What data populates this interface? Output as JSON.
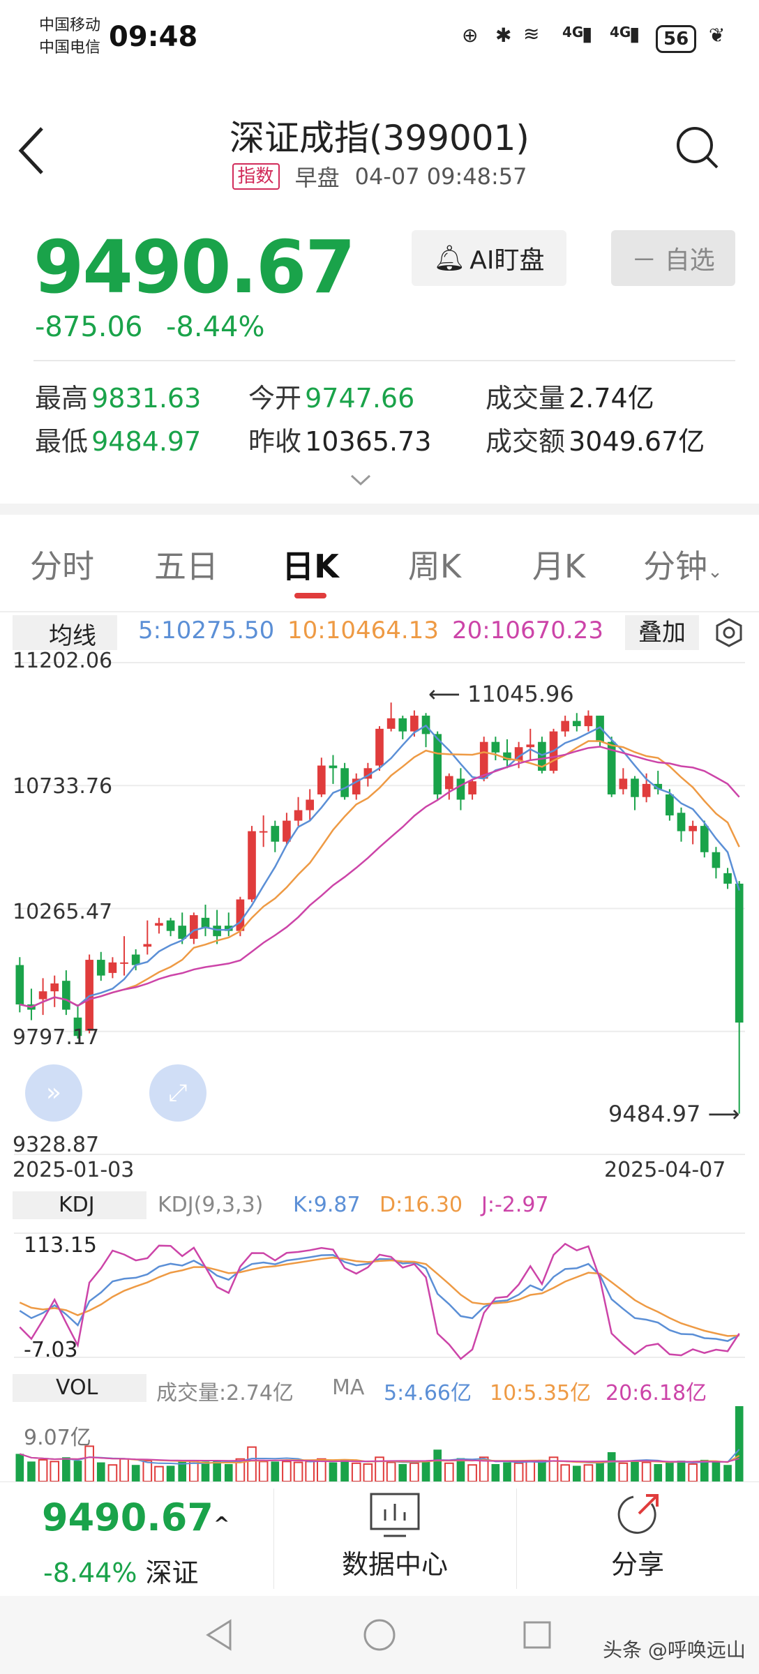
{
  "status_bar": {
    "carrier1": "中国移动",
    "carrier2": "中国电信",
    "time": "09:48",
    "signal1": "4G",
    "signal2": "4G",
    "battery": "56"
  },
  "header": {
    "title": "深证成指(399001)",
    "badge": "指数",
    "session": "早盘",
    "datetime": "04-07 09:48:57"
  },
  "quote": {
    "price": "9490.67",
    "change": "-875.06",
    "change_pct": "-8.44%",
    "ai_button": "AI盯盘",
    "fav_button": "－ 自选"
  },
  "stats": {
    "high_label": "最高",
    "high": "9831.63",
    "low_label": "最低",
    "low": "9484.97",
    "open_label": "今开",
    "open": "9747.66",
    "prev_label": "昨收",
    "prev": "10365.73",
    "vol_label": "成交量",
    "vol": "2.74亿",
    "amt_label": "成交额",
    "amt": "3049.67亿"
  },
  "tabs": [
    "分时",
    "五日",
    "日K",
    "周K",
    "月K",
    "分钟"
  ],
  "ma_bar": {
    "label": "均线",
    "ma5": "5:10275.50",
    "ma10": "10:10464.13",
    "ma20": "20:10670.23",
    "overlay": "叠加"
  },
  "kline": {
    "y_labels": [
      "11202.06",
      "10733.76",
      "10265.47",
      "9797.17",
      "9328.87"
    ],
    "high_mark": "11045.96",
    "low_mark": "9484.97",
    "date_start": "2025-01-03",
    "date_end": "2025-04-07"
  },
  "kdj": {
    "label": "KDJ",
    "params": "KDJ(9,3,3)",
    "k": "K:9.87",
    "d": "D:16.30",
    "j": "J:-2.97",
    "y_top": "113.15",
    "y_bottom": "-7.03"
  },
  "vol": {
    "label": "VOL",
    "amount": "成交量:2.74亿",
    "ma": "MA",
    "ma5": "5:4.66亿",
    "ma10": "10:5.35亿",
    "ma20": "20:6.18亿",
    "y_top": "9.07亿"
  },
  "bottom": {
    "price": "9490.67",
    "pct": "-8.44%",
    "market": "深证",
    "data_center": "数据中心",
    "share": "分享"
  },
  "watermark": "头条 @呼唤远山",
  "colors": {
    "up": "#e03c3c",
    "down": "#1aa34a",
    "ma5": "#5b8fd6",
    "ma10": "#ee9a44",
    "ma20": "#cc44a8"
  },
  "chart_data": {
    "type": "candlestick",
    "x_start": "2025-01-03",
    "x_end": "2025-04-07",
    "ylim": [
      9328.87,
      11202.06
    ],
    "candles": [
      [
        10050,
        10080,
        9900,
        9870
      ],
      [
        9900,
        9960,
        9880,
        9840
      ],
      [
        9920,
        10000,
        9950,
        9860
      ],
      [
        9950,
        10010,
        9980,
        9890
      ],
      [
        9990,
        10030,
        9880,
        9860
      ],
      [
        9850,
        9900,
        9780,
        9770
      ],
      [
        9800,
        10090,
        10070,
        9790
      ],
      [
        10070,
        10100,
        10010,
        9990
      ],
      [
        10020,
        10080,
        10060,
        10000
      ],
      [
        10060,
        10160,
        10060,
        10010
      ],
      [
        10090,
        10110,
        10050,
        10030
      ],
      [
        10120,
        10220,
        10130,
        10090
      ],
      [
        10200,
        10230,
        10210,
        10170
      ],
      [
        10220,
        10230,
        10180,
        10160
      ],
      [
        10200,
        10250,
        10150,
        10130
      ],
      [
        10150,
        10250,
        10240,
        10130
      ],
      [
        10230,
        10280,
        10190,
        10160
      ],
      [
        10200,
        10260,
        10160,
        10130
      ],
      [
        10200,
        10250,
        10180,
        10160
      ],
      [
        10180,
        10310,
        10300,
        10160
      ],
      [
        10300,
        10580,
        10560,
        10290
      ],
      [
        10560,
        10620,
        10560,
        10500
      ],
      [
        10580,
        10600,
        10520,
        10480
      ],
      [
        10520,
        10630,
        10600,
        10510
      ],
      [
        10600,
        10690,
        10640,
        10580
      ],
      [
        10640,
        10720,
        10680,
        10600
      ],
      [
        10700,
        10840,
        10810,
        10690
      ],
      [
        10810,
        10850,
        10800,
        10740
      ],
      [
        10800,
        10820,
        10690,
        10680
      ],
      [
        10700,
        10780,
        10760,
        10680
      ],
      [
        10760,
        10820,
        10800,
        10730
      ],
      [
        10810,
        10960,
        10950,
        10790
      ],
      [
        10950,
        11050,
        10990,
        10940
      ],
      [
        10990,
        11000,
        10940,
        10910
      ],
      [
        10940,
        11020,
        11000,
        10920
      ],
      [
        11000,
        11010,
        10930,
        10880
      ],
      [
        10930,
        10940,
        10700,
        10680
      ],
      [
        10720,
        10780,
        10770,
        10680
      ],
      [
        10760,
        10800,
        10680,
        10640
      ],
      [
        10700,
        10760,
        10750,
        10680
      ],
      [
        10760,
        10920,
        10900,
        10750
      ],
      [
        10900,
        10920,
        10860,
        10830
      ],
      [
        10860,
        10910,
        10830,
        10800
      ],
      [
        10830,
        10900,
        10880,
        10800
      ],
      [
        10880,
        10950,
        10890,
        10830
      ],
      [
        10900,
        10920,
        10790,
        10780
      ],
      [
        10790,
        10950,
        10940,
        10780
      ],
      [
        10940,
        11000,
        10980,
        10920
      ],
      [
        10980,
        11010,
        10960,
        10940
      ],
      [
        10960,
        11020,
        11000,
        10940
      ],
      [
        11000,
        11000,
        10900,
        10880
      ],
      [
        10900,
        10920,
        10700,
        10690
      ],
      [
        10720,
        10800,
        10760,
        10700
      ],
      [
        10760,
        10770,
        10690,
        10640
      ],
      [
        10690,
        10780,
        10740,
        10670
      ],
      [
        10740,
        10790,
        10720,
        10700
      ],
      [
        10700,
        10720,
        10620,
        10600
      ],
      [
        10630,
        10650,
        10560,
        10520
      ],
      [
        10560,
        10600,
        10580,
        10510
      ],
      [
        10580,
        10600,
        10480,
        10460
      ],
      [
        10480,
        10500,
        10420,
        10380
      ],
      [
        10400,
        10420,
        10360,
        10340
      ],
      [
        10360,
        10370,
        9831,
        9484
      ]
    ]
  }
}
